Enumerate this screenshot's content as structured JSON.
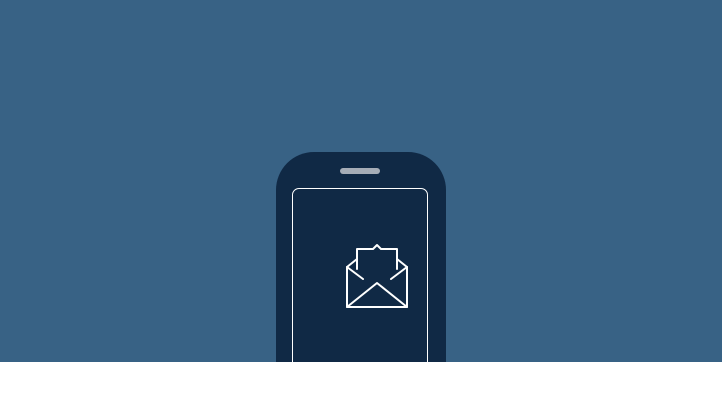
{
  "colors": {
    "background": "#386285",
    "phone_body": "#102945",
    "speaker": "#a6adb7",
    "screen_border": "#ffffff",
    "icon_stroke": "#ffffff",
    "footer": "#ffffff"
  },
  "illustration": {
    "device": "smartphone",
    "screen_icon": "open-envelope-icon"
  }
}
